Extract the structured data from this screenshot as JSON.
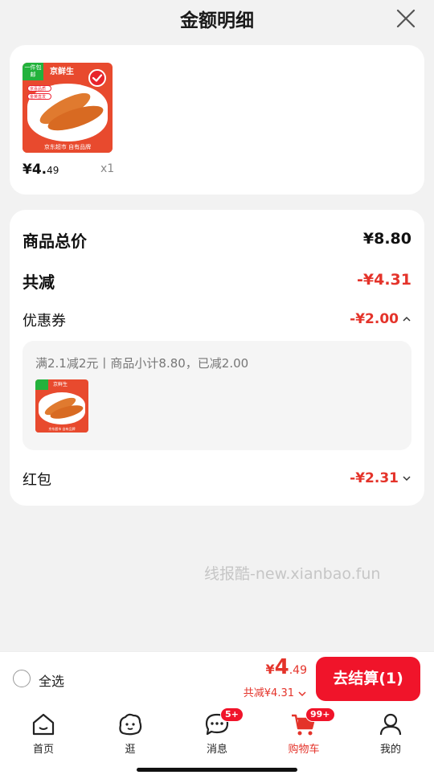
{
  "header": {
    "title": "金额明细"
  },
  "product": {
    "ribbon": "一件包邮",
    "brand": "京鲜生",
    "tag1": "京喜品质",
    "tag2": "金黄直发",
    "footer": "京东超市 自有品牌",
    "price_int": "¥4.",
    "price_dec": "49",
    "quantity": "x1"
  },
  "summary": {
    "total_label": "商品总价",
    "total_value": "¥8.80",
    "reduced_label": "共减",
    "reduced_value": "-¥4.31",
    "coupon_label": "优惠券",
    "coupon_value": "-¥2.00",
    "coupon_desc": "满2.1减2元丨商品小计8.80，已减2.00",
    "redpacket_label": "红包",
    "redpacket_value": "-¥2.31"
  },
  "watermark": "线报酷-new.xianbao.fun",
  "bottom": {
    "select_all": "全选",
    "price_yen": "¥",
    "price_int": "4",
    "price_dec": ".49",
    "saved": "共减¥4.31",
    "checkout": "去结算(1)"
  },
  "tabs": [
    {
      "label": "首页",
      "icon": "home-icon"
    },
    {
      "label": "逛",
      "icon": "browse-icon"
    },
    {
      "label": "消息",
      "icon": "message-icon",
      "badge": "5+"
    },
    {
      "label": "购物车",
      "icon": "cart-icon",
      "badge": "99+",
      "active": true
    },
    {
      "label": "我的",
      "icon": "profile-icon"
    }
  ],
  "colors": {
    "accent": "#e4332a",
    "checkout": "#f0142a",
    "background": "#f2f2f2"
  }
}
